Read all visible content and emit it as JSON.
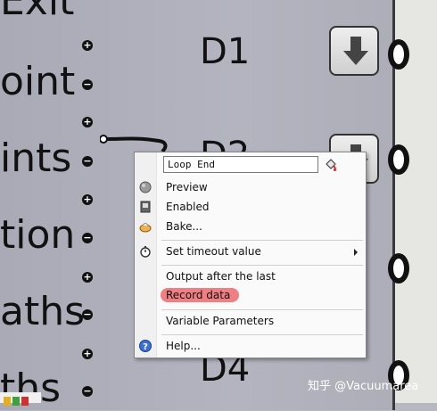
{
  "inputs": {
    "labels": [
      "Exit",
      "oint",
      "ints",
      "tion",
      "aths",
      "ths"
    ]
  },
  "outputs": {
    "labels": [
      "D1",
      "D2",
      "D4"
    ]
  },
  "context_menu": {
    "name_field_value": "Loop End",
    "items": [
      {
        "label": "Preview",
        "icon": "preview-icon"
      },
      {
        "label": "Enabled",
        "icon": "enabled-icon"
      },
      {
        "label": "Bake...",
        "icon": "bake-icon"
      },
      {
        "label": "Set timeout value",
        "icon": "stopwatch-icon",
        "submenu": true
      },
      {
        "label": "Output after the last",
        "icon": null
      },
      {
        "label": "Record data",
        "icon": null,
        "highlighted": true
      },
      {
        "label": "Variable Parameters",
        "icon": null
      },
      {
        "label": "Help...",
        "icon": "help-icon"
      }
    ]
  },
  "watermark": "知乎 @Vacuumarea",
  "colors": {
    "highlight": "#ef7f82",
    "canvas": "#b7b8c0"
  }
}
